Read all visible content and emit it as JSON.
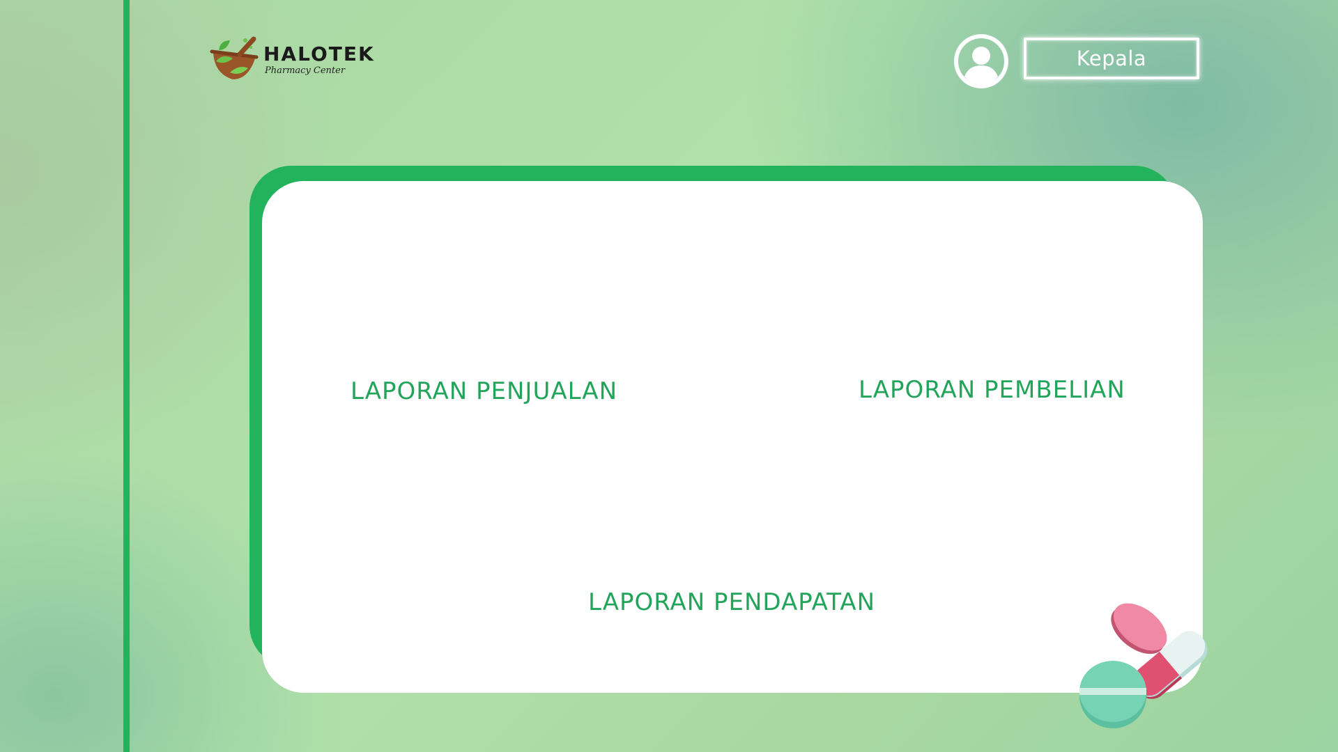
{
  "header": {
    "logo": {
      "title": "HALOTEK",
      "subtitle": "Pharmacy Center",
      "icon": "mortar-pestle-leaf-icon"
    },
    "user": {
      "avatar_icon": "user-circle-icon",
      "role_label": "Kepala"
    }
  },
  "menu": {
    "items": [
      {
        "label": "LAPORAN PENJUALAN"
      },
      {
        "label": "LAPORAN PEMBELIAN"
      },
      {
        "label": "LAPORAN PENDAPATAN"
      }
    ]
  },
  "decoration": {
    "icon": "pills-capsule-icon"
  },
  "colors": {
    "accent_green": "#22b35c",
    "link_green": "#22a45a",
    "card_bg": "#ffffff"
  }
}
